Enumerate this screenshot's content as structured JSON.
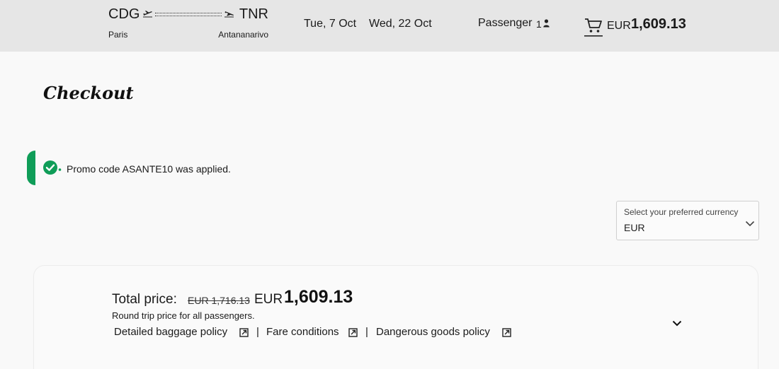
{
  "header": {
    "origin": {
      "code": "CDG",
      "city": "Paris"
    },
    "destination": {
      "code": "TNR",
      "city": "Antananarivo"
    },
    "outbound_date": "Tue, 7 Oct",
    "return_date": "Wed, 22 Oct",
    "passenger_label": "Passenger",
    "passenger_count": "1",
    "cart_currency": "EUR",
    "cart_amount": "1,609.13"
  },
  "page": {
    "title": "Checkout"
  },
  "promo": {
    "message": "Promo code ASANTE10 was applied.",
    "status_color": "#0f9d58"
  },
  "currency_select": {
    "label": "Select your preferred currency",
    "value": "EUR"
  },
  "price": {
    "label": "Total price:",
    "original": "EUR 1,716.13",
    "currency": "EUR",
    "amount": "1,609.13",
    "note": "Round trip price for all passengers."
  },
  "links": {
    "baggage": "Detailed baggage policy",
    "fare": "Fare conditions",
    "dangerous": "Dangerous goods policy",
    "separator": "|"
  },
  "icons": [
    "plane-takeoff-icon",
    "plane-landing-icon",
    "person-icon",
    "cart-icon",
    "check-circle-icon",
    "chevron-down-icon",
    "external-link-icon"
  ]
}
